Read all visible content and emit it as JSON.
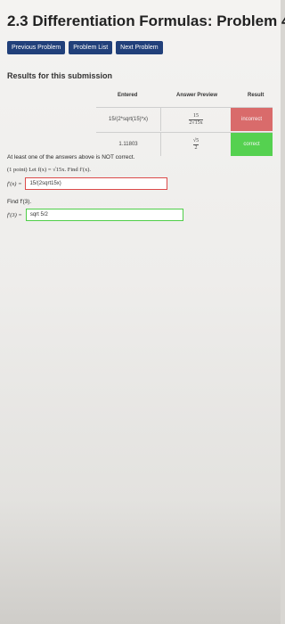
{
  "page": {
    "title": "2.3 Differentiation Formulas: Problem 4"
  },
  "nav": {
    "previous": "Previous Problem",
    "list": "Problem List",
    "next": "Next Problem"
  },
  "results": {
    "heading": "Results for this submission",
    "columns": {
      "entered": "Entered",
      "preview": "Answer Preview",
      "result": "Result"
    },
    "rows": [
      {
        "entered": "15/(2*sqrt(15)*x)",
        "preview_num": "15",
        "preview_den": "2√15x",
        "result": "incorrect",
        "status_color": "#d96b6b"
      },
      {
        "entered": "1.11803",
        "preview_num": "√5",
        "preview_den": "2",
        "result": "correct",
        "status_color": "#55d150"
      }
    ]
  },
  "feedback": {
    "warning": "At least one of the answers above is NOT correct."
  },
  "problem": {
    "statement": "(1 point) Let f(x) = √15x. Find f′(x).",
    "answer1_label": "f′(x) =",
    "answer1_value": "15/(2sqrt15x)",
    "find_text": "Find f′(3).",
    "answer2_label": "f′(3) =",
    "answer2_value": "sqrt 5/2"
  }
}
